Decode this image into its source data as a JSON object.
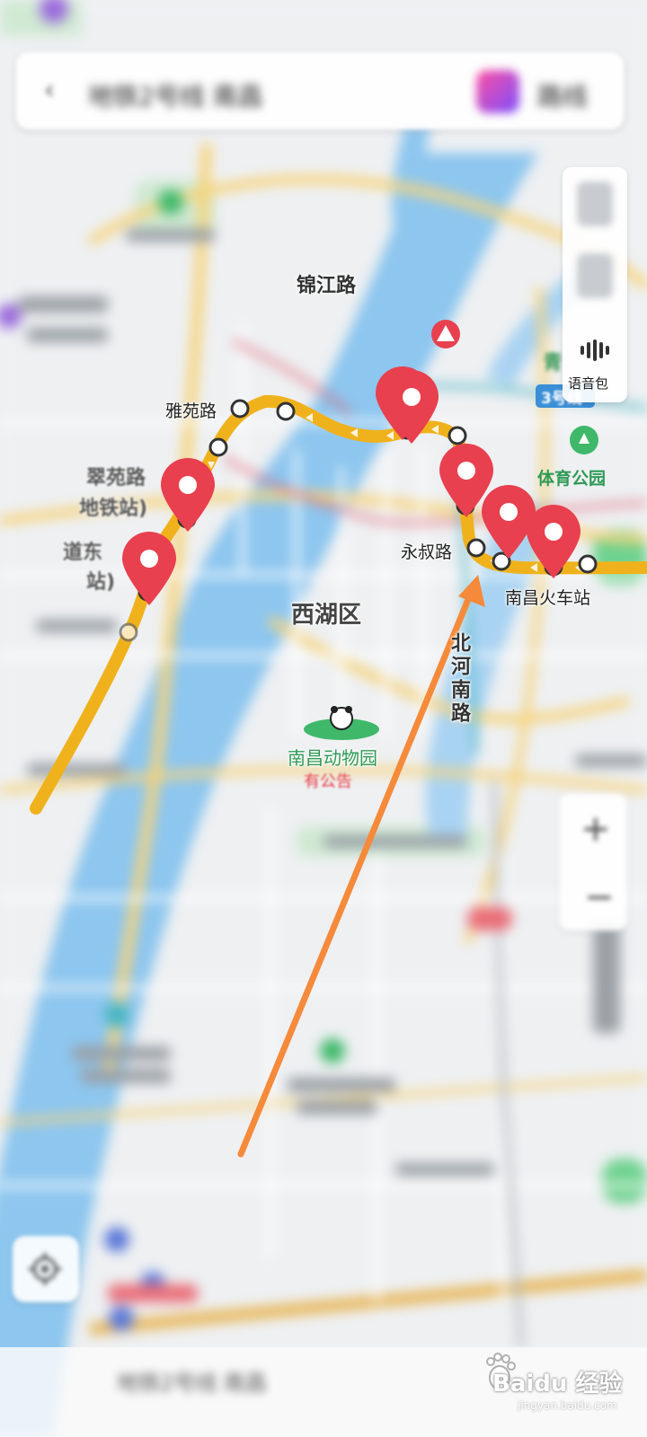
{
  "search_bar": {
    "back_icon": "chevron-left-icon",
    "query": "地铁2号线 南昌",
    "extra_label": "路线"
  },
  "side_panel": {
    "top_icon": "layers-icon",
    "voice_icon": "voice-wave-icon",
    "voice_label": "语音包"
  },
  "zoom": {
    "plus": "+",
    "minus": "−"
  },
  "locate_icon": "locate-crosshair-icon",
  "labels": {
    "jinjiang_road": "锦江路",
    "yayuan_road": "雅苑路",
    "cuiyuan_road_1": "翠苑路",
    "cuiyuan_road_2": "地铁站)",
    "dao_dong_1": "道东",
    "dao_dong_2": "站)",
    "yongshu_road": "永叔路",
    "nanchang_station": "南昌火车站",
    "xihu_district": "西湖区",
    "north_river_south_road": "北河南路",
    "tiyu_park": "体育公园",
    "zoo": "南昌动物园",
    "zoo_notice": "有公告",
    "line3_badge": "3号线",
    "blurred_qing": "青"
  },
  "bottom_bar": {
    "text": "地铁2号线 南昌"
  },
  "watermark": {
    "brand": "Baidu 经验",
    "url": "jingyan.baidu.com"
  },
  "colors": {
    "route": "#f0b21c",
    "pin": "#e8404e",
    "water": "#8dc6ef",
    "arrow": "#f58a3a",
    "road": "#f7d37a",
    "green": "#2e9a55"
  }
}
